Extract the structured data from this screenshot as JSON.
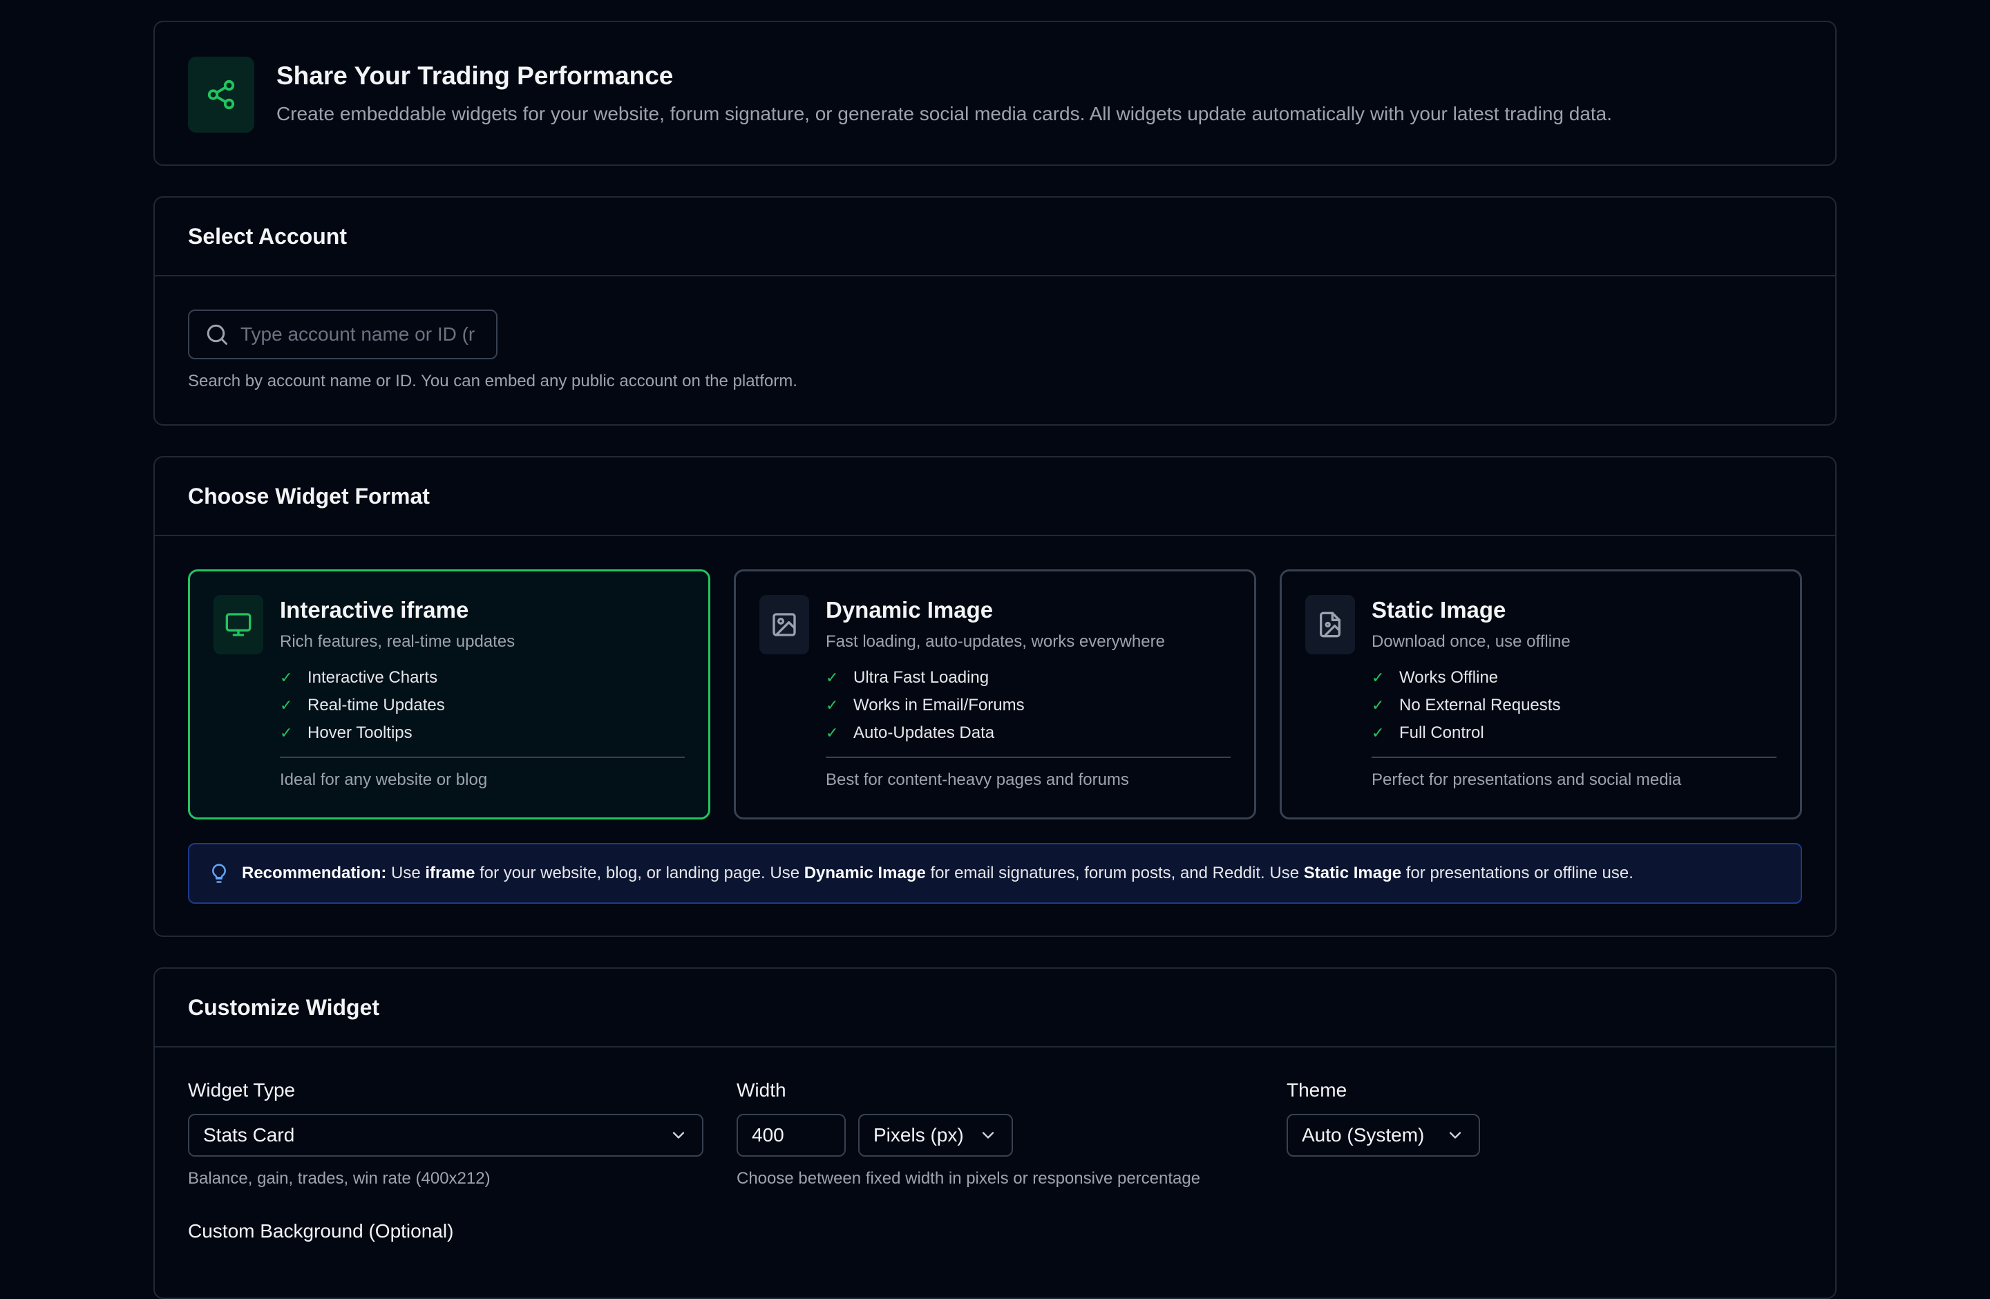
{
  "hero": {
    "title": "Share Your Trading Performance",
    "subtitle": "Create embeddable widgets for your website, forum signature, or generate social media cards. All widgets update automatically with your latest trading data."
  },
  "select_account": {
    "title": "Select Account",
    "placeholder": "Type account name or ID (r",
    "help": "Search by account name or ID. You can embed any public account on the platform."
  },
  "widget_format": {
    "title": "Choose Widget Format",
    "formats": [
      {
        "title": "Interactive iframe",
        "subtitle": "Rich features, real-time updates",
        "features": [
          "Interactive Charts",
          "Real-time Updates",
          "Hover Tooltips"
        ],
        "footer": "Ideal for any website or blog",
        "selected": true
      },
      {
        "title": "Dynamic Image",
        "subtitle": "Fast loading, auto-updates, works everywhere",
        "features": [
          "Ultra Fast Loading",
          "Works in Email/Forums",
          "Auto-Updates Data"
        ],
        "footer": "Best for content-heavy pages and forums",
        "selected": false
      },
      {
        "title": "Static Image",
        "subtitle": "Download once, use offline",
        "features": [
          "Works Offline",
          "No External Requests",
          "Full Control"
        ],
        "footer": "Perfect for presentations and social media",
        "selected": false
      }
    ],
    "recommendation": {
      "label": "Recommendation:",
      "t1": "Use",
      "b1": "iframe",
      "t2": "for your website, blog, or landing page. Use",
      "b2": "Dynamic Image",
      "t3": "for email signatures, forum posts, and Reddit. Use",
      "b3": "Static Image",
      "t4": "for presentations or offline use."
    }
  },
  "customize": {
    "title": "Customize Widget",
    "widget_type": {
      "label": "Widget Type",
      "value": "Stats Card",
      "help": "Balance, gain, trades, win rate (400x212)"
    },
    "width": {
      "label": "Width",
      "value": "400",
      "unit": "Pixels (px)",
      "help": "Choose between fixed width in pixels or responsive percentage"
    },
    "theme": {
      "label": "Theme",
      "value": "Auto (System)"
    },
    "custom_background_label": "Custom Background (Optional)"
  },
  "colors": {
    "accent": "#22c55e",
    "background": "#030712",
    "border": "#1f2937",
    "info_border": "#1e3a8a"
  }
}
